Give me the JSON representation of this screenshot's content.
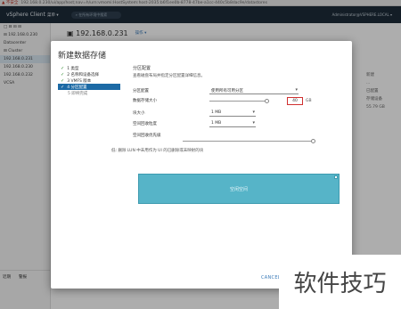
{
  "browser": {
    "warning": "▲ 不安全",
    "url": "192.168.0.230/ui/app/host;nav=h/urn:vmomi:HostSystem:host-2035:b6f1ee0b-8778-47be-a1cc-440c5b8dac9e/datastores"
  },
  "app": {
    "brand": "vSphere Client",
    "menu_label": "菜单 ▾",
    "search_placeholder": "在所有环境中搜索",
    "user": "Administrator@VSPHERE.LOCAL ▾"
  },
  "left_tree": {
    "items": [
      {
        "label": "□ ⊟ ⊟ ⊟"
      },
      {
        "label": "⊟ 192.168.0.230"
      },
      {
        "label": "  Datacenter"
      },
      {
        "label": "  ⊟ Cluster"
      },
      {
        "label": "    192.168.0.231"
      },
      {
        "label": "    192.168.0.230"
      },
      {
        "label": "    192.168.0.232"
      },
      {
        "label": "    VCSA"
      }
    ],
    "bottom_tabs": [
      "近期",
      "警报"
    ]
  },
  "main_header": {
    "title": "▣ 192.168.0.231",
    "actions": "操作 ▾"
  },
  "right_column": {
    "items": [
      "新建",
      "...",
      "已配置",
      "存储设备",
      "55.79 GB"
    ]
  },
  "dialog": {
    "title": "新建数据存储",
    "steps": [
      {
        "label": "1 类型",
        "state": "done"
      },
      {
        "label": "2 名称和设备选择",
        "state": "done"
      },
      {
        "label": "3 VMFS 版本",
        "state": "done"
      },
      {
        "label": "4 分区配置",
        "state": "active"
      },
      {
        "label": "5 即将完成",
        "state": "todo"
      }
    ],
    "section_title": "分区配置",
    "section_desc": "查看磁盘布局并指定分区配置详细信息。",
    "fields": {
      "partition_label": "分区配置",
      "partition_value": "使用所有可用分区",
      "size_label": "数据存储大小",
      "size_value": "40",
      "size_unit": "GB",
      "block_label": "块大小",
      "block_value": "1 MB",
      "reclaim_gran_label": "空间回收粒度",
      "reclaim_gran_value": "1 MB",
      "reclaim_prio_label": "空间回收优先级",
      "reclaim_prio_value": "低: 删除 LUN 中未用作为 UI 的已删除或未映射的块"
    },
    "preview_label": "空闲空间",
    "cancel_label": "CANCEL"
  },
  "watermark": "软件技巧",
  "colors": {
    "accent": "#1c6aa5",
    "preview": "#56b4c8",
    "highlight_box": "#d03030",
    "header": "#1c2b39"
  }
}
